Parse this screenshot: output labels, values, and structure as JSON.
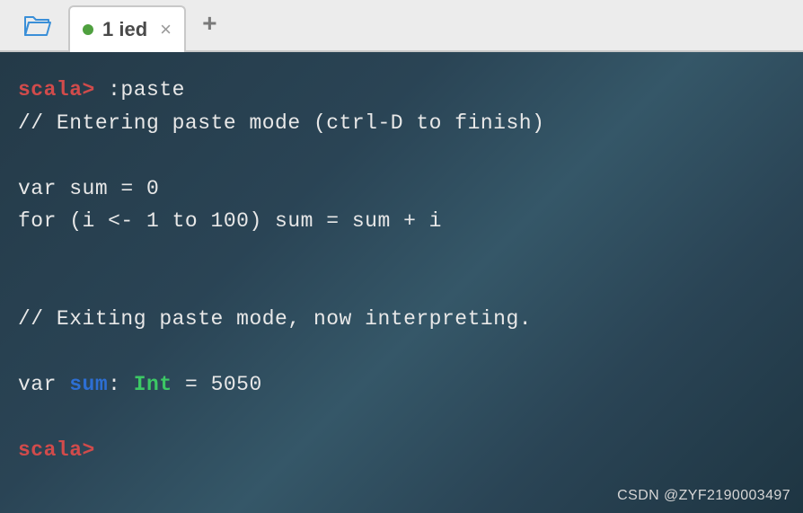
{
  "tabbar": {
    "tab_label": "1 ied",
    "close_glyph": "×",
    "newtab_glyph": "+"
  },
  "terminal": {
    "prompt1_scala": "scala> ",
    "prompt1_cmd": ":paste",
    "paste_enter": "// Entering paste mode (ctrl-D to finish)",
    "code1": "var sum = 0",
    "code2": "for (i <- 1 to 100) sum = sum + i",
    "paste_exit": "// Exiting paste mode, now interpreting.",
    "result_prefix": "var ",
    "result_sum": "sum",
    "result_colon": ": ",
    "result_type": "Int",
    "result_rest": " = 5050",
    "prompt2_scala": "scala>"
  },
  "watermark": "CSDN @ZYF2190003497"
}
